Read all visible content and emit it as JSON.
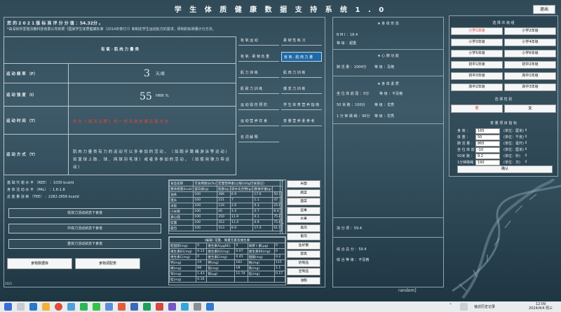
{
  "window": {
    "title": "学 生 体 质 健 康 数 据 支 持 系 统 1 . 0",
    "exit_label": "退出"
  },
  "score": {
    "title": "您 的 2 0 2 1 版 标 准 评 分 分 值 ：54.32分 。",
    "note": "*由深圳市爱祖法教科技有限公司依照《国家学生体质健康标准（2014年修订）》和制定学生运动处方的需求，研制的标准量计分方法。"
  },
  "exercise": {
    "header": "有 氧 · 肌 肉 力 量 类",
    "frequency_label": "运 动 频 率 （F）",
    "frequency_value": "3",
    "frequency_unit": "天/周",
    "intensity_label": "运 动 强 度 （I）",
    "intensity_value": "55",
    "intensity_unit": "HRR %",
    "time_label": "运 动 时 间 （T）",
    "time_value": "举 办 《 拔 河 比 赛 》 的 一 些 有 效 的 建 议 和 方 法",
    "method_label": "运 动 方 式 （T）",
    "method_value": "肌 肉 力 量 类 有 力 的 运 动 可 以 多 参 加 的 活 动 ， （ 如 跑 步 跳 绳 游 泳 等 运 动 ） 如 篮 球 上 肢 、 球 、 网 球 羽 毛 球 ） 或 者 多 参 加 的 活 动 ， （ 如 使 用 弹 力 带 运 动 ）"
  },
  "menu": [
    {
      "label": "有 氧 运 动",
      "active": false
    },
    {
      "label": "柔 韧 性 练 习",
      "active": false
    },
    {
      "label": "有 氧 · 柔 韧 负 重",
      "active": false
    },
    {
      "label": "有 氧 · 肌 肉 力 量",
      "active": true
    },
    {
      "label": "肌 力 训 练",
      "active": false
    },
    {
      "label": "肌 肉 力 训 练",
      "active": false
    },
    {
      "label": "肌 耐 力 训 练",
      "active": false
    },
    {
      "label": "爆 发 力 训 练",
      "active": false
    },
    {
      "label": "运 动 损 伤 预 防",
      "active": false
    },
    {
      "label": "学 生 体 育 营 养 指 南",
      "active": false
    },
    {
      "label": "运 动 营 养 饮 食",
      "active": false
    },
    {
      "label": "变 量 营 养 素 参 考",
      "active": false
    },
    {
      "label": "名 词 解 释",
      "active": false
    }
  ],
  "calories": {
    "line1": "基 础 代 谢 水 平 （REE） ：1030 kcal/d",
    "line2": "身 体 活 动 水 平 （PAL） ：1.6-1.8",
    "line3": "总 能 量 消 耗 （TEE） ：2282-2656 kcal/d"
  },
  "states": [
    "低体力活动状态下食谱",
    "中体力活动状态下食谱",
    "重体力活动状态下食谱"
  ],
  "bottom_buttons": {
    "left": "食物数据库",
    "right": "食物调配表"
  },
  "copyright": "2021",
  "food_table": {
    "top_header": "宏量营养素(以每100g可食部记)",
    "columns": [
      "食品名称",
      "可食用部分(%)",
      "膳食能量(kcal)",
      "蛋白质(g)",
      "脂肪(g)",
      "碳水化合物(g)",
      "膳食纤维(g)"
    ],
    "rows": [
      [
        "油条",
        "100",
        "386",
        "6.9",
        "17.6",
        "50.1",
        "0.9"
      ],
      [
        "馒头",
        "100",
        "221",
        "7",
        "1.1",
        "47",
        "1.3"
      ],
      [
        "米饭",
        "100",
        "116",
        "2.6",
        "0.3",
        "25.9",
        "0.3"
      ],
      [
        "小米粥",
        "100",
        "46",
        "1.4",
        "0.7",
        "8.4",
        "0"
      ],
      [
        "通心面",
        "100",
        "350",
        "11.9",
        "0.1",
        "75.8",
        "0.4"
      ],
      [
        "挂面",
        "100",
        "353",
        "11.4",
        "0.9",
        "75.6",
        "0.5"
      ],
      [
        "面包",
        "100",
        "313",
        "8.9",
        "17.0",
        "61.0",
        "0.5"
      ]
    ]
  },
  "mineral_table": {
    "header": "(编辑) 常量、微量元素及维生素",
    "rows": [
      [
        "胆固醇(mg)",
        "0",
        "维生素A(μgRE)",
        "0",
        "胡萝卜素(μg)",
        "0"
      ],
      [
        "维生素B1(mg)",
        "0.12",
        "维生素B2(mg)",
        "0.07",
        "维生素B6(mg)",
        "0"
      ],
      [
        "维生素C(mg)",
        "0",
        "维生素E(mg)",
        "0.45",
        "烟酸(mg)",
        "0.2"
      ],
      [
        "钙(mg)",
        "19",
        "钾(mg)",
        "162",
        "钠(mg)",
        "115"
      ],
      [
        "磷(mg)",
        "88",
        "镁(mg)",
        "18",
        "铁(mg)",
        "1.1"
      ],
      [
        "锌(mg)",
        "1.43",
        "铜(μg)",
        "11.74",
        "锰(mg)",
        "0.17"
      ],
      [
        "锰(mg)",
        "0.16",
        "",
        "",
        "",
        ""
      ]
    ]
  },
  "food_categories": [
    "米面",
    "蔬菜",
    "菌菜",
    "坚果",
    "水果",
    "禽肉",
    "畜肉",
    "鱼虾蟹",
    "蛋类",
    "奶制品",
    "豆制品",
    "油脂"
  ],
  "middle_panel": {
    "body_title": "★ 身 体 形 态",
    "bmi": "B M I ：18.4",
    "bmi_level": "等 级 ：超重",
    "cardio_title": "★ 心 肺 功 能",
    "vital_capacity": "肺 活 量 ：1004分",
    "vital_level": "等 级 ：及格",
    "quality_title": "★ 身 体 素 质",
    "sitreach": "坐 位 体 前 屈 ：0分",
    "sitreach_level": "等 级 ：不及格",
    "sprint": "50 米 跑 ：100分",
    "sprint_level": "等 级 ：优秀",
    "rope": "1 分 钟 跳 绳 ：90分",
    "rope_level": "等 级 ：优秀",
    "extra_score": "加 分 项 ：59.4",
    "total_score": "综 合 总 分 ：59.4",
    "total_level": "综 合 等 级 ：不及格"
  },
  "random_label": "random]",
  "grade": {
    "title": "选 择 年 级 组",
    "options": [
      "小学1年级",
      "小学2年级",
      "小学3年级",
      "小学4年级",
      "小学5年级",
      "小学6年级",
      "初中1年级",
      "初中2年级",
      "初中3年级",
      "高中1年级",
      "高中2年级",
      "高中3年级"
    ],
    "selected": "小学1年级"
  },
  "gender": {
    "title": "选 择 性 别",
    "options": [
      "男",
      "女"
    ],
    "selected": "男"
  },
  "measure": {
    "title": "变 量 项 目 指 标",
    "fields": [
      {
        "label": "身 高 ：",
        "value": "165",
        "unit": "(单位：厘米)"
      },
      {
        "label": "体 重 ：",
        "value": "50",
        "unit": "(单位：千克)"
      },
      {
        "label": "肺 活 量 ：",
        "value": "865",
        "unit": "(单位：毫升)"
      },
      {
        "label": "坐 位 体 前 屈 ：",
        "value": "-10",
        "unit": "(单位：厘米)"
      },
      {
        "label": "50米 跑 ：",
        "value": "9.2",
        "unit": "(单位：秒)"
      },
      {
        "label": "1分钟跳绳 ：",
        "value": "190",
        "unit": "(单位：次)"
      }
    ],
    "confirm_label": "确认"
  },
  "taskbar": {
    "history_label": "袖访历史记录",
    "time": "12:09",
    "date": "2024/4/4 周三"
  },
  "colors": {
    "accent": "#1f6aa8",
    "selected_text": "#e03a33",
    "warning_text": "#e8463c"
  }
}
